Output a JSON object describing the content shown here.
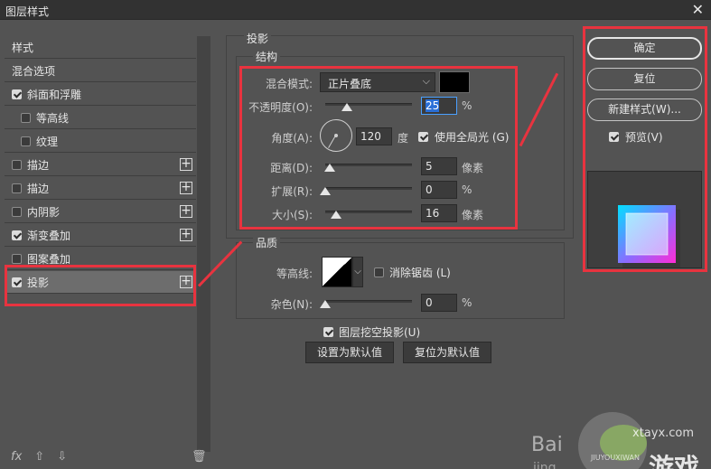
{
  "window": {
    "title": "图层样式",
    "close_glyph": "✕"
  },
  "style_list": {
    "items": [
      {
        "label": "样式",
        "checkbox": false,
        "plus": false,
        "selected": false
      },
      {
        "label": "混合选项",
        "checkbox": false,
        "plus": false,
        "selected": false
      },
      {
        "label": "斜面和浮雕",
        "checkbox": true,
        "checked": true,
        "plus": false,
        "selected": false
      },
      {
        "label": "等高线",
        "checkbox": true,
        "checked": false,
        "plus": false,
        "selected": false,
        "indent": true
      },
      {
        "label": "纹理",
        "checkbox": true,
        "checked": false,
        "plus": false,
        "selected": false,
        "indent": true
      },
      {
        "label": "描边",
        "checkbox": true,
        "checked": false,
        "plus": true,
        "selected": false
      },
      {
        "label": "描边",
        "checkbox": true,
        "checked": false,
        "plus": true,
        "selected": false
      },
      {
        "label": "内阴影",
        "checkbox": true,
        "checked": false,
        "plus": true,
        "selected": false
      },
      {
        "label": "渐变叠加",
        "checkbox": true,
        "checked": true,
        "plus": true,
        "selected": false
      },
      {
        "label": "图案叠加",
        "checkbox": true,
        "checked": false,
        "plus": false,
        "selected": false
      },
      {
        "label": "投影",
        "checkbox": true,
        "checked": true,
        "plus": true,
        "selected": true
      }
    ],
    "plus_glyph": "+",
    "fx_label": "fx",
    "up_glyph": "⇧",
    "down_glyph": "⇩",
    "trash_glyph": "🗑"
  },
  "drop_shadow": {
    "section_title": "投影",
    "structure_title": "结构",
    "blend_mode_label": "混合模式:",
    "blend_mode_value": "正片叠底",
    "blend_color": "#000000",
    "opacity_label": "不透明度(O):",
    "opacity_value": "25",
    "opacity_fraction": 0.25,
    "angle_label": "角度(A):",
    "angle_value": "120",
    "angle_unit": "度",
    "global_light_label": "使用全局光 (G)",
    "global_light_checked": true,
    "distance_label": "距离(D):",
    "distance_value": "5",
    "spread_label": "扩展(R):",
    "spread_value": "0",
    "size_label": "大小(S):",
    "size_value": "16",
    "unit_px": "像素",
    "unit_pct": "%"
  },
  "quality": {
    "title": "品质",
    "contour_label": "等高线:",
    "anti_alias_label": "消除锯齿 (L)",
    "anti_alias_checked": false,
    "noise_label": "杂色(N):",
    "noise_value": "0",
    "unit_pct": "%"
  },
  "layer_knockout_label": "图层挖空投影(U)",
  "layer_knockout_checked": true,
  "set_default_label": "设置为默认值",
  "reset_default_label": "复位为默认值",
  "right_panel": {
    "ok_label": "确定",
    "reset_label": "复位",
    "new_style_label": "新建样式(W)...",
    "preview_label": "预览(V)",
    "preview_checked": true
  },
  "watermark": {
    "line1": "Bai",
    "line2": "jing",
    "brand": "游戏",
    "site": "xtayx.com",
    "pinyin": "JIUYOUXIWAN"
  },
  "colors": {
    "annotation_red": "#e8333f",
    "panel_bg": "#535353",
    "field_bg": "#3b3b3b",
    "focus_blue": "#4aa0ff"
  }
}
